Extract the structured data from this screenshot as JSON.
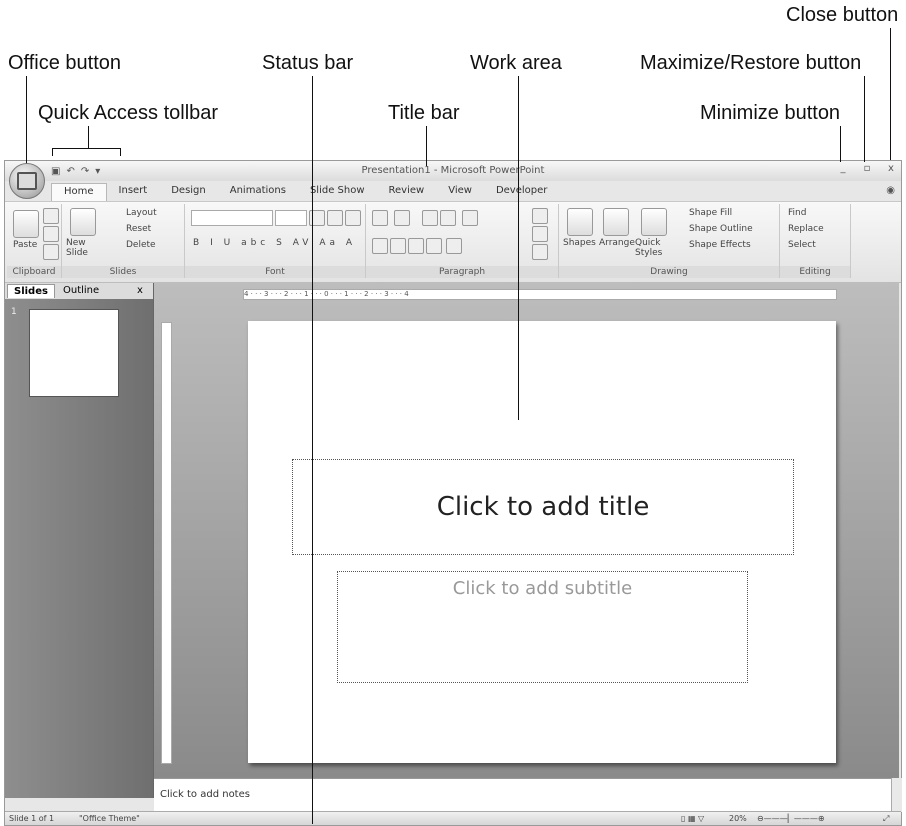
{
  "callouts": {
    "close_button": "Close button",
    "office_button": "Office button",
    "status_bar": "Status bar",
    "work_area": "Work area",
    "maximize_restore": "Maximize/Restore button",
    "quick_access": "Quick Access tollbar",
    "title_bar": "Title bar",
    "minimize_button": "Minimize button"
  },
  "window": {
    "title": "Presentation1 - Microsoft PowerPoint",
    "controls": {
      "minimize": "_",
      "restore": "▫",
      "close": "x"
    }
  },
  "tabs": [
    "Home",
    "Insert",
    "Design",
    "Animations",
    "Slide Show",
    "Review",
    "View",
    "Developer"
  ],
  "ribbon": {
    "clipboard": {
      "label": "Clipboard",
      "paste": "Paste"
    },
    "slides": {
      "label": "Slides",
      "new_slide": "New Slide",
      "layout": "Layout",
      "reset": "Reset",
      "delete": "Delete"
    },
    "font": {
      "label": "Font",
      "buttons": [
        "B",
        "I",
        "U",
        "abc",
        "S",
        "AV",
        "Aa",
        "A"
      ]
    },
    "paragraph": {
      "label": "Paragraph"
    },
    "drawing": {
      "label": "Drawing",
      "shapes": "Shapes",
      "arrange": "Arrange",
      "quick_styles": "Quick Styles",
      "shape_fill": "Shape Fill",
      "shape_outline": "Shape Outline",
      "shape_effects": "Shape Effects"
    },
    "editing": {
      "label": "Editing",
      "find": "Find",
      "replace": "Replace",
      "select": "Select"
    }
  },
  "pane": {
    "tab_slides": "Slides",
    "tab_outline": "Outline",
    "close": "x",
    "thumb_num": "1"
  },
  "ruler": {
    "h": "4 · · · 3 · · · 2 · · · 1 · · · 0 · · · 1 · · · 2 · · · 3 · · · 4"
  },
  "slide": {
    "title_placeholder": "Click to add title",
    "subtitle_placeholder": "Click to add subtitle"
  },
  "notes": {
    "placeholder": "Click to add notes"
  },
  "status": {
    "slide_count": "Slide 1 of 1",
    "theme": "\"Office Theme\"",
    "zoom": "20%"
  }
}
